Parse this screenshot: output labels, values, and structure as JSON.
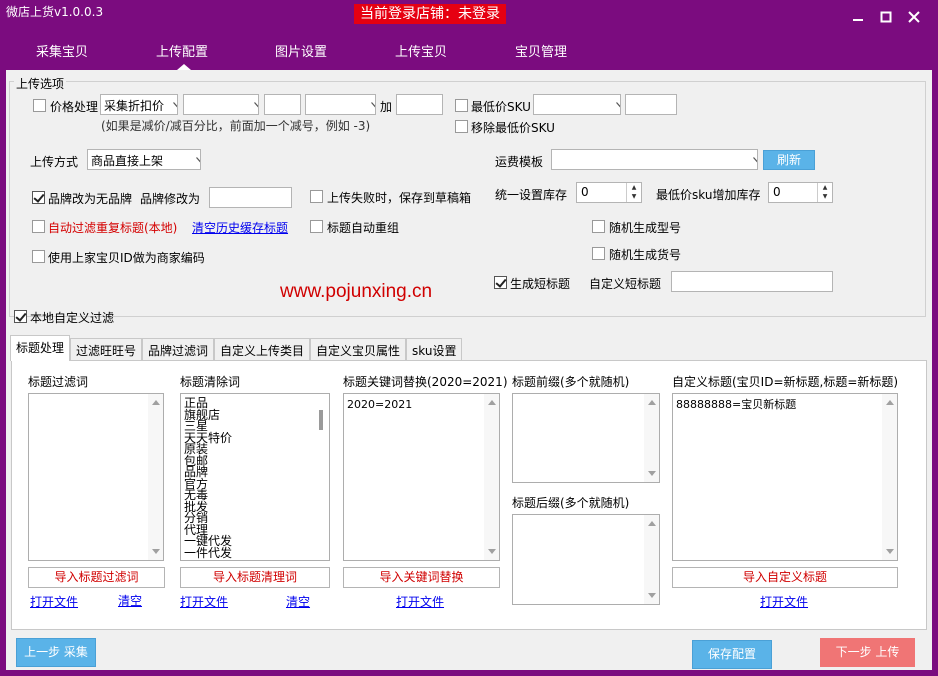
{
  "window": {
    "title": "微店上货v1.0.0.3",
    "login_status": "当前登录店铺：未登录"
  },
  "nav": {
    "items": [
      "采集宝贝",
      "上传配置",
      "图片设置",
      "上传宝贝",
      "宝贝管理"
    ],
    "active_index": 1
  },
  "upload_options": {
    "group_title": "上传选项",
    "price_processing": {
      "label": "价格处理",
      "checked": false,
      "mode_value": "采集折扣价",
      "select2_value": "",
      "input1_value": "",
      "select3_value": "",
      "plus_label": "加",
      "input2_value": "",
      "hint": "(如果是减价/减百分比，前面加一个减号，例如 -3)"
    },
    "min_price_sku": {
      "label": "最低价SKU",
      "checked": false,
      "select_value": "",
      "input_value": ""
    },
    "remove_min_price_sku": {
      "label": "移除最低价SKU",
      "checked": false
    },
    "upload_method": {
      "label": "上传方式",
      "value": "商品直接上架"
    },
    "freight_template": {
      "label": "运费模板",
      "value": "",
      "refresh_label": "刷新"
    },
    "brand_to_none": {
      "label": "品牌改为无品牌",
      "checked": true
    },
    "brand_modify": {
      "label": "品牌修改为",
      "value": ""
    },
    "save_draft_on_fail": {
      "label": "上传失败时，保存到草稿箱",
      "checked": false
    },
    "unified_stock": {
      "label": "统一设置库存",
      "value": "0"
    },
    "min_sku_add_stock": {
      "label": "最低价sku增加库存",
      "value": "0"
    },
    "auto_filter_duplicate": {
      "label": "自动过滤重复标题(本地)",
      "checked": false
    },
    "clear_history_link": "清空历史缓存标题",
    "title_auto_regroup": {
      "label": "标题自动重组",
      "checked": false
    },
    "random_model": {
      "label": "随机生成型号",
      "checked": false
    },
    "random_goods_no": {
      "label": "随机生成货号",
      "checked": false
    },
    "use_supplier_id": {
      "label": "使用上家宝贝ID做为商家编码",
      "checked": false
    },
    "short_title": {
      "label": "生成短标题",
      "checked": true
    },
    "custom_short_title": {
      "label": "自定义短标题",
      "value": ""
    }
  },
  "watermark_text": "www.pojunxing.cn",
  "local_custom_filter": {
    "label": "本地自定义过滤",
    "checked": true
  },
  "sub_tabs": [
    "标题处理",
    "过滤旺旺号",
    "品牌过滤词",
    "自定义上传类目",
    "自定义宝贝属性",
    "sku设置"
  ],
  "sub_tab_active": 0,
  "title_panel": {
    "filter_words": {
      "label": "标题过滤词",
      "lines": [],
      "import_label": "导入标题过滤词",
      "open_label": "打开文件",
      "clear_label": "清空"
    },
    "clear_words": {
      "label": "标题清除词",
      "lines": [
        "正品",
        "旗舰店",
        "三星",
        "天天特价",
        "原装",
        "包邮",
        "品牌",
        "官方",
        "无毒",
        "批发",
        "分销",
        "代理",
        "一键代发",
        "一件代发"
      ],
      "import_label": "导入标题清理词",
      "open_label": "打开文件",
      "clear_label": "清空"
    },
    "keyword_replace": {
      "label": "标题关键词替换(2020=2021)",
      "lines": [
        "2020=2021"
      ],
      "import_label": "导入关键词替换",
      "open_label": "打开文件"
    },
    "prefix": {
      "label": "标题前缀(多个就随机)",
      "lines": []
    },
    "suffix": {
      "label": "标题后缀(多个就随机)",
      "lines": []
    },
    "custom_title": {
      "label": "自定义标题(宝贝ID=新标题,标题=新标题)",
      "lines": [
        "88888888=宝贝新标题"
      ],
      "import_label": "导入自定义标题",
      "open_label": "打开文件"
    }
  },
  "footer": {
    "prev_label": "上一步 采集",
    "save_label": "保存配置",
    "next_label": "下一步 上传"
  },
  "colors": {
    "frame": "#7b0c7f",
    "login_badge": "#e60012",
    "button_blue": "#5ab3e8",
    "button_red": "#f07575"
  }
}
